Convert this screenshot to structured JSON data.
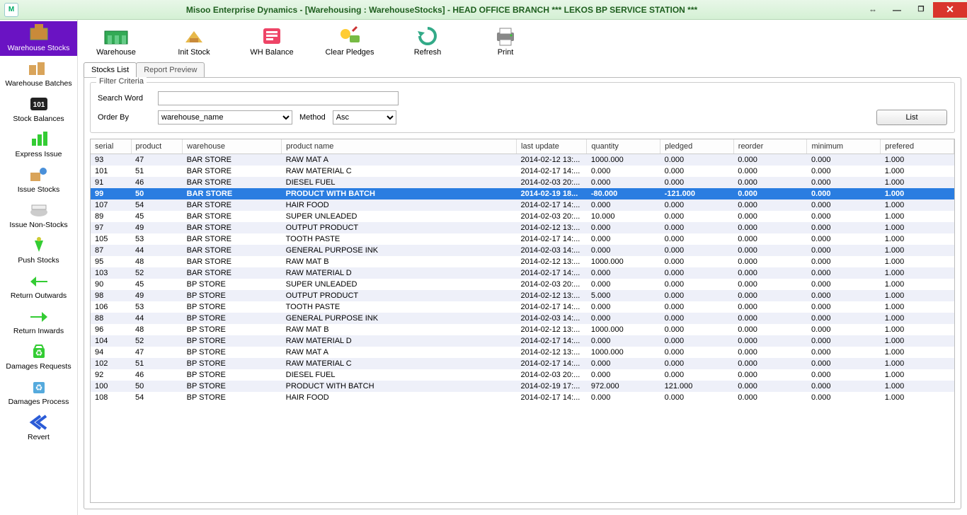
{
  "title": "Misoo Enterprise Dynamics - [Warehousing : WarehouseStocks] - HEAD OFFICE BRANCH *** LEKOS BP SERVICE STATION ***",
  "sidebar": {
    "items": [
      {
        "label": "Warehouse Stocks"
      },
      {
        "label": "Warehouse Batches"
      },
      {
        "label": "Stock Balances"
      },
      {
        "label": "Express Issue"
      },
      {
        "label": "Issue Stocks"
      },
      {
        "label": "Issue Non-Stocks"
      },
      {
        "label": "Push Stocks"
      },
      {
        "label": "Return Outwards"
      },
      {
        "label": "Return Inwards"
      },
      {
        "label": "Damages Requests"
      },
      {
        "label": "Damages Process"
      },
      {
        "label": "Revert"
      }
    ]
  },
  "toolbar": {
    "items": [
      {
        "label": "Warehouse"
      },
      {
        "label": "Init Stock"
      },
      {
        "label": "WH Balance"
      },
      {
        "label": "Clear Pledges"
      },
      {
        "label": "Refresh"
      },
      {
        "label": "Print"
      }
    ]
  },
  "tabs": {
    "active": "Stocks List",
    "inactive": "Report Preview"
  },
  "filter": {
    "legend": "Filter Criteria",
    "searchLabel": "Search Word",
    "orderLabel": "Order By",
    "orderValue": "warehouse_name",
    "methodLabel": "Method",
    "methodValue": "Asc",
    "listBtn": "List"
  },
  "columns": [
    "serial",
    "product",
    "warehouse",
    "product name",
    "last update",
    "quantity",
    "pledged",
    "reorder",
    "minimum",
    "prefered"
  ],
  "rows": [
    {
      "serial": "93",
      "product": "47",
      "wh": "BAR STORE",
      "name": "RAW MAT A",
      "upd": "2014-02-12 13:...",
      "qty": "1000.000",
      "pl": "0.000",
      "re": "0.000",
      "min": "0.000",
      "pref": "1.000"
    },
    {
      "serial": "101",
      "product": "51",
      "wh": "BAR STORE",
      "name": "RAW MATERIAL C",
      "upd": "2014-02-17 14:...",
      "qty": "0.000",
      "pl": "0.000",
      "re": "0.000",
      "min": "0.000",
      "pref": "1.000"
    },
    {
      "serial": "91",
      "product": "46",
      "wh": "BAR STORE",
      "name": "DIESEL FUEL",
      "upd": "2014-02-03 20:...",
      "qty": "0.000",
      "pl": "0.000",
      "re": "0.000",
      "min": "0.000",
      "pref": "1.000"
    },
    {
      "serial": "99",
      "product": "50",
      "wh": "BAR STORE",
      "name": "PRODUCT WITH BATCH",
      "upd": "2014-02-19 18...",
      "qty": "-80.000",
      "pl": "-121.000",
      "re": "0.000",
      "min": "0.000",
      "pref": "1.000",
      "sel": true
    },
    {
      "serial": "107",
      "product": "54",
      "wh": "BAR STORE",
      "name": "HAIR FOOD",
      "upd": "2014-02-17 14:...",
      "qty": "0.000",
      "pl": "0.000",
      "re": "0.000",
      "min": "0.000",
      "pref": "1.000"
    },
    {
      "serial": "89",
      "product": "45",
      "wh": "BAR STORE",
      "name": "SUPER UNLEADED",
      "upd": "2014-02-03 20:...",
      "qty": "10.000",
      "pl": "0.000",
      "re": "0.000",
      "min": "0.000",
      "pref": "1.000"
    },
    {
      "serial": "97",
      "product": "49",
      "wh": "BAR STORE",
      "name": "OUTPUT PRODUCT",
      "upd": "2014-02-12 13:...",
      "qty": "0.000",
      "pl": "0.000",
      "re": "0.000",
      "min": "0.000",
      "pref": "1.000"
    },
    {
      "serial": "105",
      "product": "53",
      "wh": "BAR STORE",
      "name": "TOOTH PASTE",
      "upd": "2014-02-17 14:...",
      "qty": "0.000",
      "pl": "0.000",
      "re": "0.000",
      "min": "0.000",
      "pref": "1.000"
    },
    {
      "serial": "87",
      "product": "44",
      "wh": "BAR STORE",
      "name": "GENERAL PURPOSE INK",
      "upd": "2014-02-03 14:...",
      "qty": "0.000",
      "pl": "0.000",
      "re": "0.000",
      "min": "0.000",
      "pref": "1.000"
    },
    {
      "serial": "95",
      "product": "48",
      "wh": "BAR STORE",
      "name": "RAW MAT B",
      "upd": "2014-02-12 13:...",
      "qty": "1000.000",
      "pl": "0.000",
      "re": "0.000",
      "min": "0.000",
      "pref": "1.000"
    },
    {
      "serial": "103",
      "product": "52",
      "wh": "BAR STORE",
      "name": "RAW MATERIAL D",
      "upd": "2014-02-17 14:...",
      "qty": "0.000",
      "pl": "0.000",
      "re": "0.000",
      "min": "0.000",
      "pref": "1.000"
    },
    {
      "serial": "90",
      "product": "45",
      "wh": "BP STORE",
      "name": "SUPER UNLEADED",
      "upd": "2014-02-03 20:...",
      "qty": "0.000",
      "pl": "0.000",
      "re": "0.000",
      "min": "0.000",
      "pref": "1.000"
    },
    {
      "serial": "98",
      "product": "49",
      "wh": "BP STORE",
      "name": "OUTPUT PRODUCT",
      "upd": "2014-02-12 13:...",
      "qty": "5.000",
      "pl": "0.000",
      "re": "0.000",
      "min": "0.000",
      "pref": "1.000"
    },
    {
      "serial": "106",
      "product": "53",
      "wh": "BP STORE",
      "name": "TOOTH PASTE",
      "upd": "2014-02-17 14:...",
      "qty": "0.000",
      "pl": "0.000",
      "re": "0.000",
      "min": "0.000",
      "pref": "1.000"
    },
    {
      "serial": "88",
      "product": "44",
      "wh": "BP STORE",
      "name": "GENERAL PURPOSE INK",
      "upd": "2014-02-03 14:...",
      "qty": "0.000",
      "pl": "0.000",
      "re": "0.000",
      "min": "0.000",
      "pref": "1.000"
    },
    {
      "serial": "96",
      "product": "48",
      "wh": "BP STORE",
      "name": "RAW MAT B",
      "upd": "2014-02-12 13:...",
      "qty": "1000.000",
      "pl": "0.000",
      "re": "0.000",
      "min": "0.000",
      "pref": "1.000"
    },
    {
      "serial": "104",
      "product": "52",
      "wh": "BP STORE",
      "name": "RAW MATERIAL D",
      "upd": "2014-02-17 14:...",
      "qty": "0.000",
      "pl": "0.000",
      "re": "0.000",
      "min": "0.000",
      "pref": "1.000"
    },
    {
      "serial": "94",
      "product": "47",
      "wh": "BP STORE",
      "name": "RAW MAT A",
      "upd": "2014-02-12 13:...",
      "qty": "1000.000",
      "pl": "0.000",
      "re": "0.000",
      "min": "0.000",
      "pref": "1.000"
    },
    {
      "serial": "102",
      "product": "51",
      "wh": "BP STORE",
      "name": "RAW MATERIAL C",
      "upd": "2014-02-17 14:...",
      "qty": "0.000",
      "pl": "0.000",
      "re": "0.000",
      "min": "0.000",
      "pref": "1.000"
    },
    {
      "serial": "92",
      "product": "46",
      "wh": "BP STORE",
      "name": "DIESEL FUEL",
      "upd": "2014-02-03 20:...",
      "qty": "0.000",
      "pl": "0.000",
      "re": "0.000",
      "min": "0.000",
      "pref": "1.000"
    },
    {
      "serial": "100",
      "product": "50",
      "wh": "BP STORE",
      "name": "PRODUCT WITH BATCH",
      "upd": "2014-02-19 17:...",
      "qty": "972.000",
      "pl": "121.000",
      "re": "0.000",
      "min": "0.000",
      "pref": "1.000"
    },
    {
      "serial": "108",
      "product": "54",
      "wh": "BP STORE",
      "name": "HAIR FOOD",
      "upd": "2014-02-17 14:...",
      "qty": "0.000",
      "pl": "0.000",
      "re": "0.000",
      "min": "0.000",
      "pref": "1.000"
    }
  ]
}
